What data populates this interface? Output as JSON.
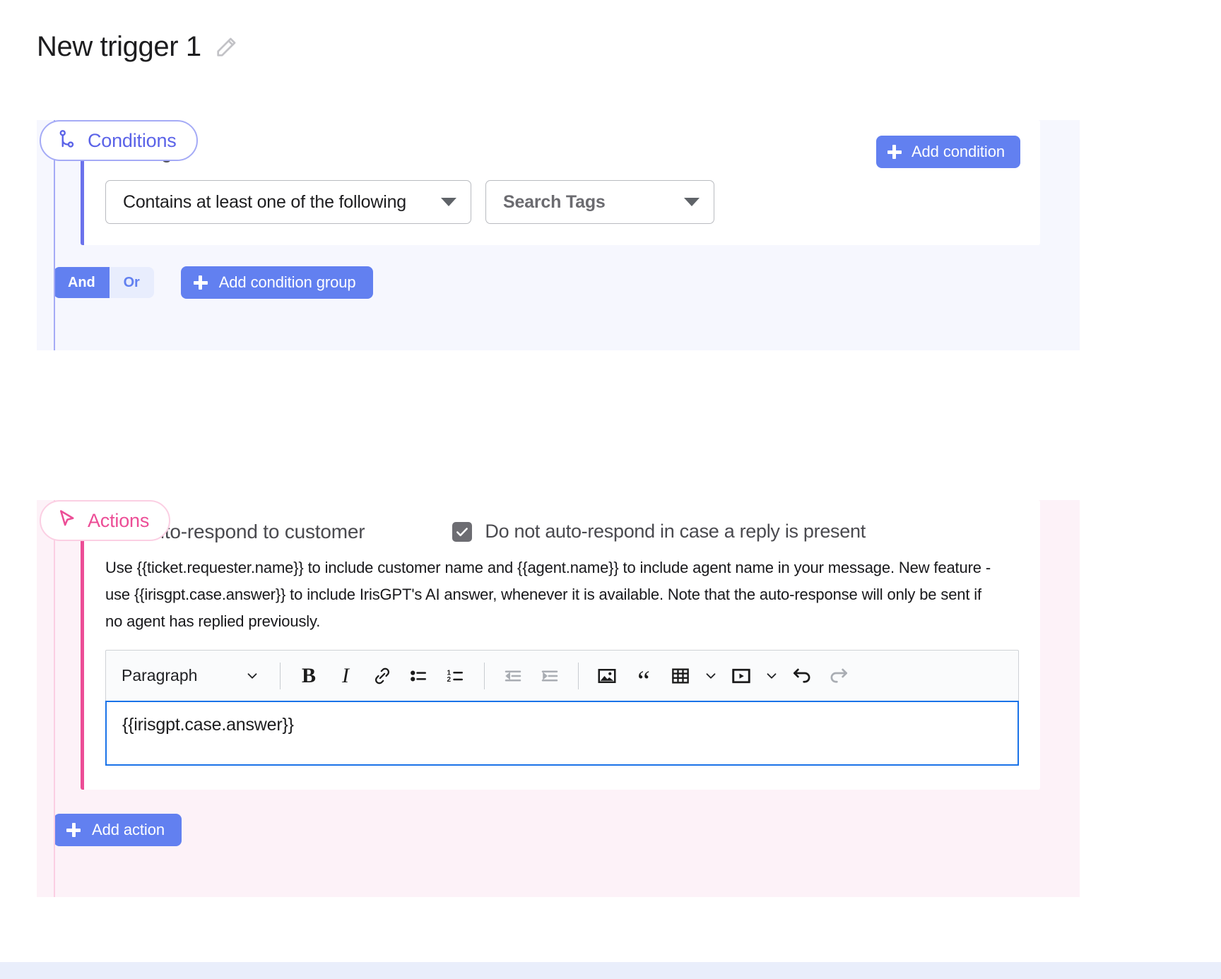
{
  "header": {
    "title": "New trigger 1",
    "edit_icon": "pencil-icon"
  },
  "conditions": {
    "pill_label": "Conditions",
    "pill_icon": "branch-icon",
    "accent_color": "#5b63e8",
    "panel_bg": "#f6f7fe",
    "card": {
      "title": "Tags",
      "icon": "tag-icon",
      "operator": {
        "value": "Contains at least one of the following",
        "icon": "caret-down-icon"
      },
      "tags": {
        "placeholder": "Search Tags",
        "value": "",
        "icon": "caret-down-icon"
      },
      "add_condition_label": "Add condition"
    },
    "logic_toggle": {
      "options": [
        "And",
        "Or"
      ],
      "selected": "And"
    },
    "add_group_label": "Add condition group"
  },
  "actions": {
    "pill_label": "Actions",
    "pill_icon": "cursor-icon",
    "accent_color": "#ec4d96",
    "panel_bg": "#fdf2f8",
    "card": {
      "title": "Auto-respond to customer",
      "icon": "speech-bubble-icon",
      "checkbox": {
        "label": "Do not auto-respond in case a reply is present",
        "checked": true
      },
      "description": "Use {{ticket.requester.name}} to include customer name and {{agent.name}} to include agent name in your message. New feature - use {{irisgpt.case.answer}} to include IrisGPT's AI answer, whenever it is available. Note that the auto-response will only be sent if no agent has replied previously.",
      "editor": {
        "block_format": "Paragraph",
        "toolbar": [
          "bold-icon",
          "italic-icon",
          "link-icon",
          "bulleted-list-icon",
          "numbered-list-icon",
          "outdent-icon",
          "indent-icon",
          "image-icon",
          "blockquote-icon",
          "table-icon",
          "table-chevron-icon",
          "media-icon",
          "media-chevron-icon",
          "undo-icon",
          "redo-icon"
        ],
        "content": "{{irisgpt.case.answer}}"
      }
    },
    "add_action_label": "Add action"
  }
}
